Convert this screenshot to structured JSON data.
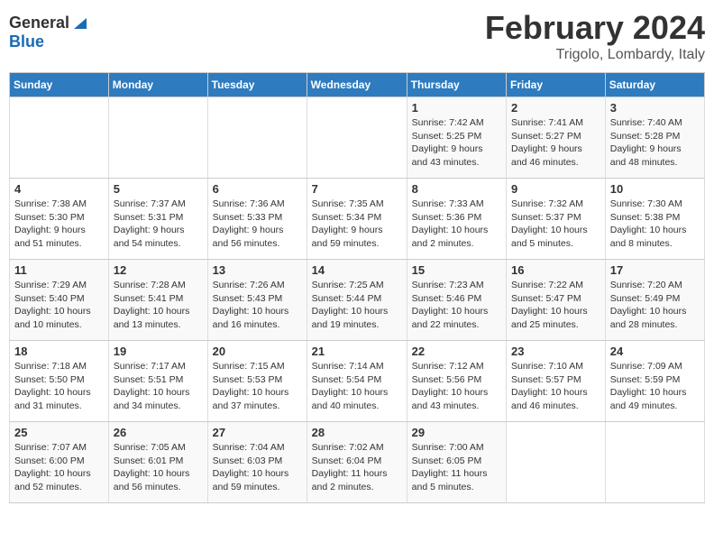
{
  "header": {
    "logo_general": "General",
    "logo_blue": "Blue",
    "month": "February 2024",
    "location": "Trigolo, Lombardy, Italy"
  },
  "days_of_week": [
    "Sunday",
    "Monday",
    "Tuesday",
    "Wednesday",
    "Thursday",
    "Friday",
    "Saturday"
  ],
  "weeks": [
    [
      {
        "day": "",
        "info": ""
      },
      {
        "day": "",
        "info": ""
      },
      {
        "day": "",
        "info": ""
      },
      {
        "day": "",
        "info": ""
      },
      {
        "day": "1",
        "info": "Sunrise: 7:42 AM\nSunset: 5:25 PM\nDaylight: 9 hours\nand 43 minutes."
      },
      {
        "day": "2",
        "info": "Sunrise: 7:41 AM\nSunset: 5:27 PM\nDaylight: 9 hours\nand 46 minutes."
      },
      {
        "day": "3",
        "info": "Sunrise: 7:40 AM\nSunset: 5:28 PM\nDaylight: 9 hours\nand 48 minutes."
      }
    ],
    [
      {
        "day": "4",
        "info": "Sunrise: 7:38 AM\nSunset: 5:30 PM\nDaylight: 9 hours\nand 51 minutes."
      },
      {
        "day": "5",
        "info": "Sunrise: 7:37 AM\nSunset: 5:31 PM\nDaylight: 9 hours\nand 54 minutes."
      },
      {
        "day": "6",
        "info": "Sunrise: 7:36 AM\nSunset: 5:33 PM\nDaylight: 9 hours\nand 56 minutes."
      },
      {
        "day": "7",
        "info": "Sunrise: 7:35 AM\nSunset: 5:34 PM\nDaylight: 9 hours\nand 59 minutes."
      },
      {
        "day": "8",
        "info": "Sunrise: 7:33 AM\nSunset: 5:36 PM\nDaylight: 10 hours\nand 2 minutes."
      },
      {
        "day": "9",
        "info": "Sunrise: 7:32 AM\nSunset: 5:37 PM\nDaylight: 10 hours\nand 5 minutes."
      },
      {
        "day": "10",
        "info": "Sunrise: 7:30 AM\nSunset: 5:38 PM\nDaylight: 10 hours\nand 8 minutes."
      }
    ],
    [
      {
        "day": "11",
        "info": "Sunrise: 7:29 AM\nSunset: 5:40 PM\nDaylight: 10 hours\nand 10 minutes."
      },
      {
        "day": "12",
        "info": "Sunrise: 7:28 AM\nSunset: 5:41 PM\nDaylight: 10 hours\nand 13 minutes."
      },
      {
        "day": "13",
        "info": "Sunrise: 7:26 AM\nSunset: 5:43 PM\nDaylight: 10 hours\nand 16 minutes."
      },
      {
        "day": "14",
        "info": "Sunrise: 7:25 AM\nSunset: 5:44 PM\nDaylight: 10 hours\nand 19 minutes."
      },
      {
        "day": "15",
        "info": "Sunrise: 7:23 AM\nSunset: 5:46 PM\nDaylight: 10 hours\nand 22 minutes."
      },
      {
        "day": "16",
        "info": "Sunrise: 7:22 AM\nSunset: 5:47 PM\nDaylight: 10 hours\nand 25 minutes."
      },
      {
        "day": "17",
        "info": "Sunrise: 7:20 AM\nSunset: 5:49 PM\nDaylight: 10 hours\nand 28 minutes."
      }
    ],
    [
      {
        "day": "18",
        "info": "Sunrise: 7:18 AM\nSunset: 5:50 PM\nDaylight: 10 hours\nand 31 minutes."
      },
      {
        "day": "19",
        "info": "Sunrise: 7:17 AM\nSunset: 5:51 PM\nDaylight: 10 hours\nand 34 minutes."
      },
      {
        "day": "20",
        "info": "Sunrise: 7:15 AM\nSunset: 5:53 PM\nDaylight: 10 hours\nand 37 minutes."
      },
      {
        "day": "21",
        "info": "Sunrise: 7:14 AM\nSunset: 5:54 PM\nDaylight: 10 hours\nand 40 minutes."
      },
      {
        "day": "22",
        "info": "Sunrise: 7:12 AM\nSunset: 5:56 PM\nDaylight: 10 hours\nand 43 minutes."
      },
      {
        "day": "23",
        "info": "Sunrise: 7:10 AM\nSunset: 5:57 PM\nDaylight: 10 hours\nand 46 minutes."
      },
      {
        "day": "24",
        "info": "Sunrise: 7:09 AM\nSunset: 5:59 PM\nDaylight: 10 hours\nand 49 minutes."
      }
    ],
    [
      {
        "day": "25",
        "info": "Sunrise: 7:07 AM\nSunset: 6:00 PM\nDaylight: 10 hours\nand 52 minutes."
      },
      {
        "day": "26",
        "info": "Sunrise: 7:05 AM\nSunset: 6:01 PM\nDaylight: 10 hours\nand 56 minutes."
      },
      {
        "day": "27",
        "info": "Sunrise: 7:04 AM\nSunset: 6:03 PM\nDaylight: 10 hours\nand 59 minutes."
      },
      {
        "day": "28",
        "info": "Sunrise: 7:02 AM\nSunset: 6:04 PM\nDaylight: 11 hours\nand 2 minutes."
      },
      {
        "day": "29",
        "info": "Sunrise: 7:00 AM\nSunset: 6:05 PM\nDaylight: 11 hours\nand 5 minutes."
      },
      {
        "day": "",
        "info": ""
      },
      {
        "day": "",
        "info": ""
      }
    ]
  ]
}
